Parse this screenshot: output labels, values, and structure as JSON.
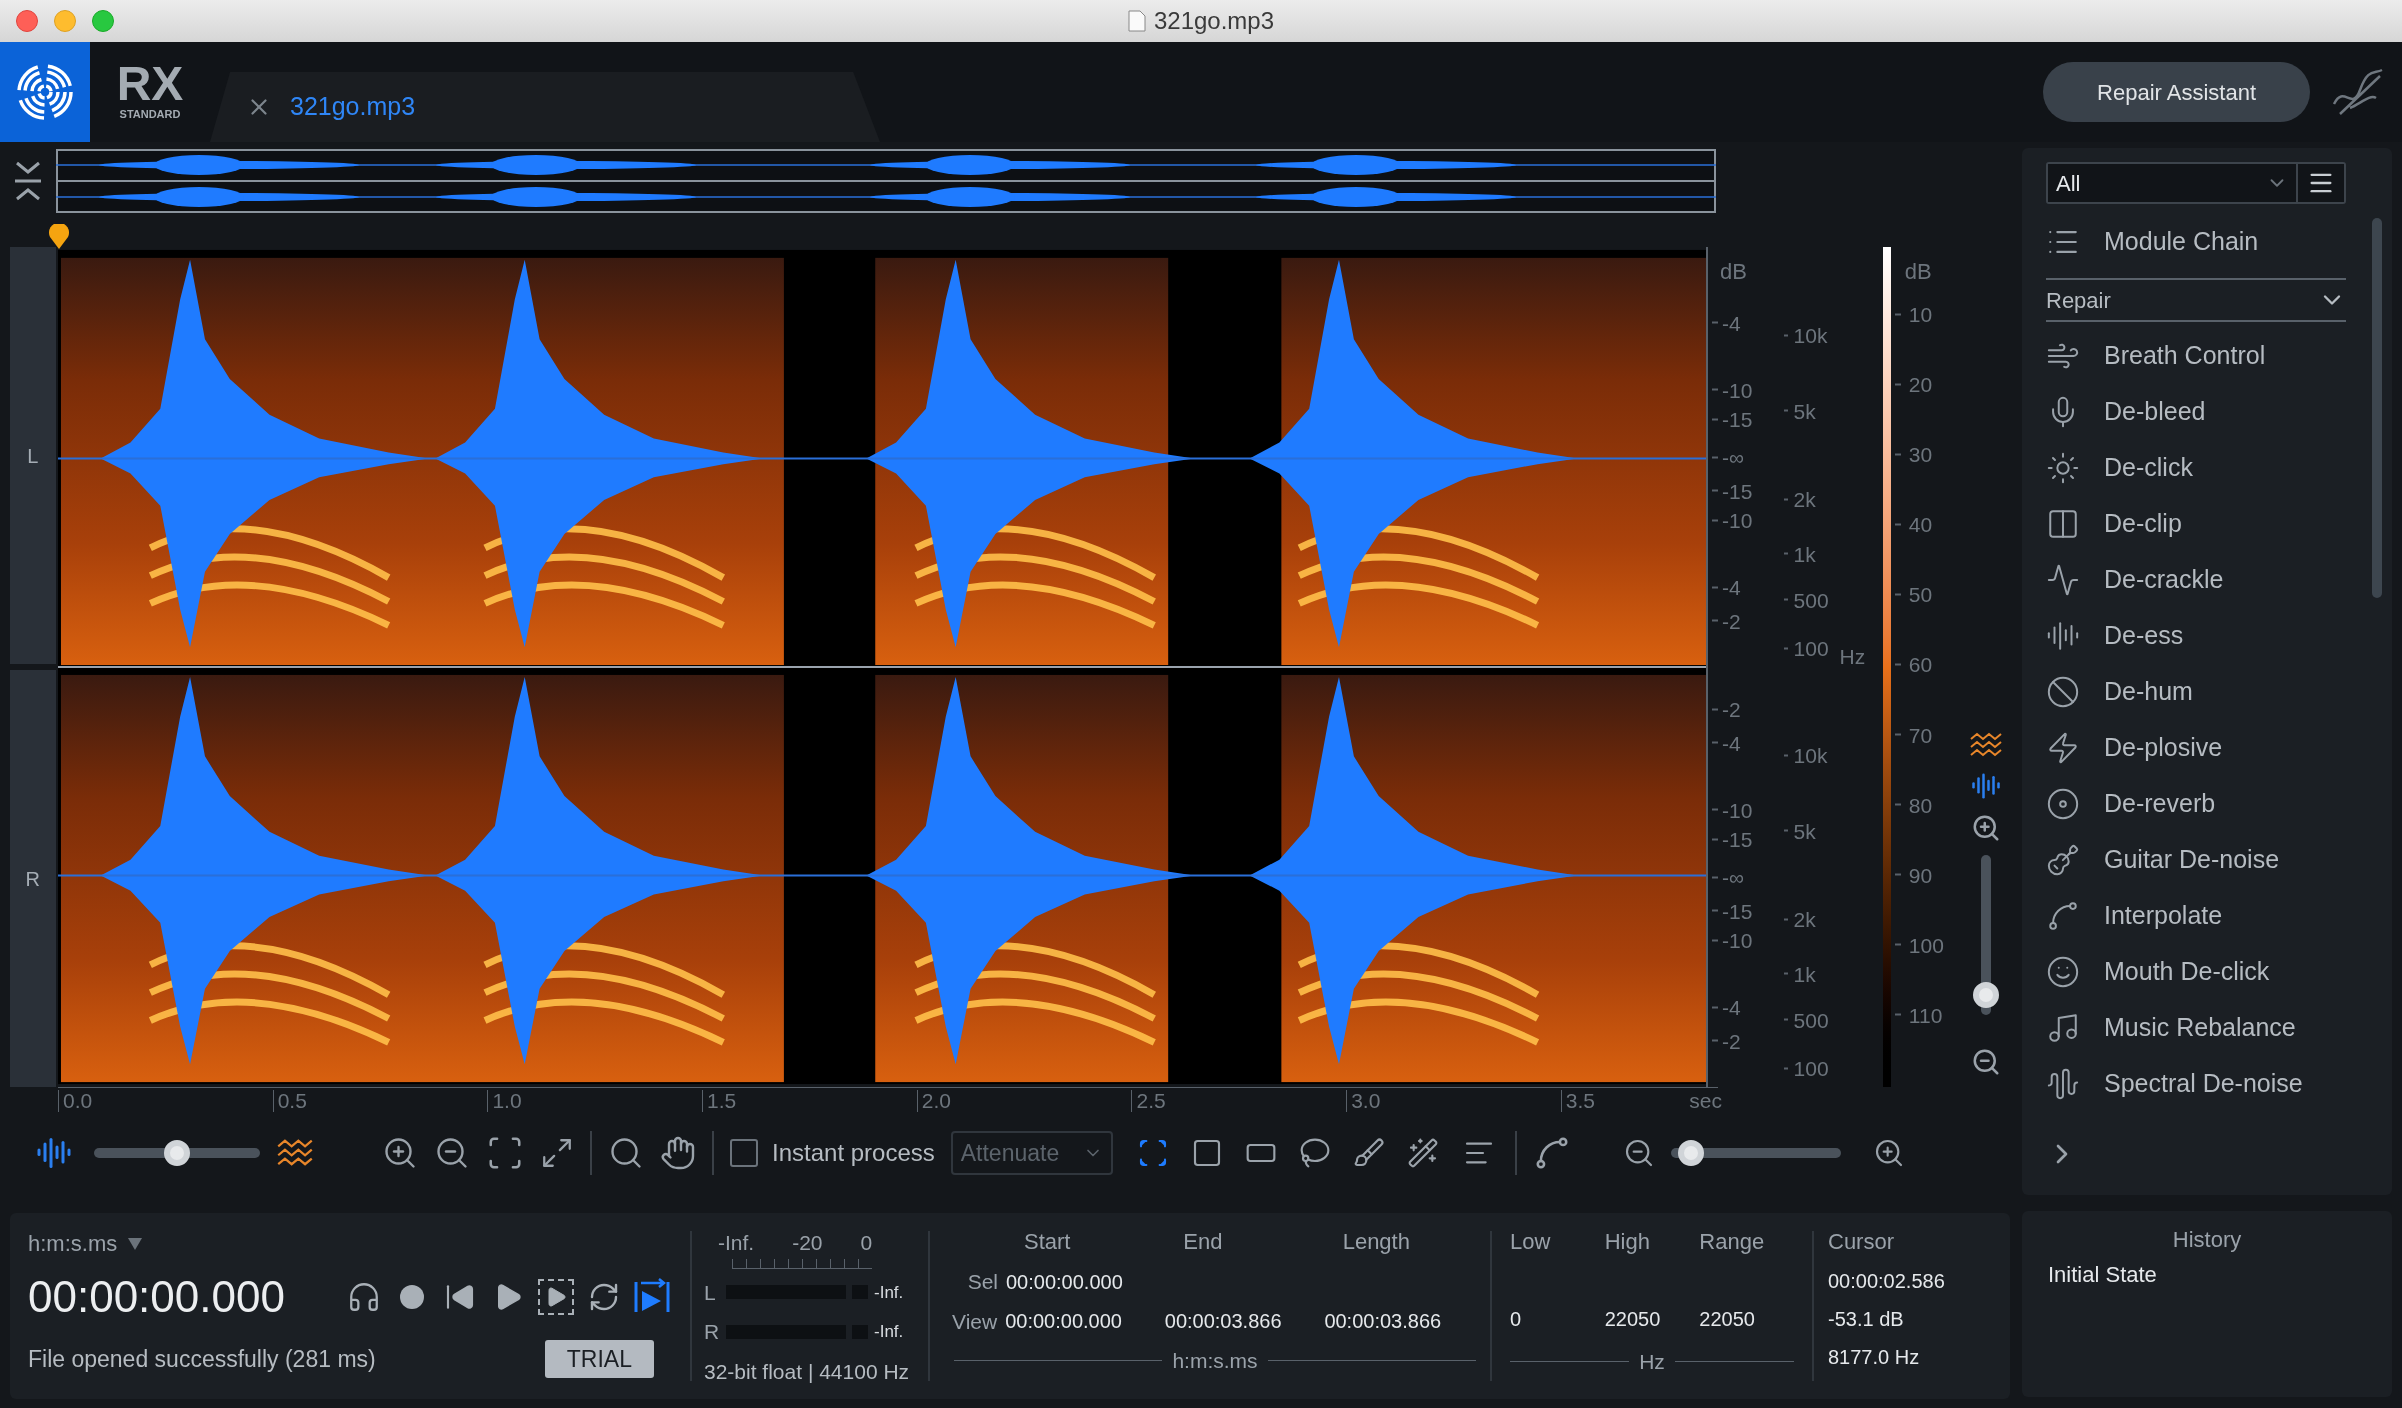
{
  "window": {
    "title": "321go.mp3"
  },
  "app": {
    "logo_text": "RX",
    "edition": "STANDARD"
  },
  "tabs": [
    {
      "label": "321go.mp3",
      "selected": true
    }
  ],
  "repair_assistant_button": "Repair Assistant",
  "channels": [
    {
      "label": "L",
      "db_unit": "dB",
      "db_ticks": [
        "-4",
        "-10",
        "-15",
        "-∞",
        "-15",
        "-10",
        "-4",
        "-2"
      ],
      "hz_ticks": [
        "10k",
        "5k",
        "2k",
        "1k",
        "500",
        "100"
      ],
      "hz_unit": "Hz"
    },
    {
      "label": "R",
      "db_ticks": [
        "-2",
        "-4",
        "-10",
        "-15",
        "-∞",
        "-15",
        "-10",
        "-4",
        "-2"
      ],
      "hz_ticks": [
        "10k",
        "5k",
        "2k",
        "1k",
        "500",
        "100"
      ]
    }
  ],
  "colorbar": {
    "unit": "dB",
    "ticks": [
      "10",
      "20",
      "30",
      "40",
      "50",
      "60",
      "70",
      "80",
      "90",
      "100",
      "110"
    ]
  },
  "vertical_zoom_slider": {
    "level": 0.05
  },
  "time_axis": {
    "ticks": [
      "0.0",
      "0.5",
      "1.0",
      "1.5",
      "2.0",
      "2.5",
      "3.0",
      "3.5"
    ],
    "unit": "sec"
  },
  "toolbar": {
    "blend_slider": {
      "level": 0.5
    },
    "instant_process": {
      "label": "Instant process",
      "checked": false
    },
    "mode_dropdown": {
      "value": "Attenuate",
      "disabled": true
    },
    "selection_tools": [
      {
        "kind": "time",
        "selected": true
      },
      {
        "kind": "rect",
        "selected": false
      },
      {
        "kind": "frequency",
        "selected": false
      },
      {
        "kind": "lasso",
        "selected": false
      },
      {
        "kind": "brush",
        "selected": false
      },
      {
        "kind": "wand",
        "selected": false
      },
      {
        "kind": "harmonic",
        "selected": false
      }
    ],
    "zoom_slider": {
      "level": 0.05
    }
  },
  "modules": {
    "filter": "All",
    "module_chain": "Module Chain",
    "category": "Repair",
    "items": [
      "Breath Control",
      "De-bleed",
      "De-click",
      "De-clip",
      "De-crackle",
      "De-ess",
      "De-hum",
      "De-plosive",
      "De-reverb",
      "Guitar De-noise",
      "Interpolate",
      "Mouth De-click",
      "Music Rebalance",
      "Spectral De-noise"
    ]
  },
  "transport": {
    "time_format": "h:m:s.ms",
    "time": "00:00:00.000",
    "status": "File opened successfully (281 ms)",
    "trial_button": "TRIAL",
    "buttons": [
      {
        "kind": "monitor",
        "on": false
      },
      {
        "kind": "record",
        "on": false
      },
      {
        "kind": "rewind",
        "on": false
      },
      {
        "kind": "play",
        "on": false
      },
      {
        "kind": "play_selection",
        "on": false
      },
      {
        "kind": "loop",
        "on": false
      },
      {
        "kind": "follow",
        "on": true
      }
    ]
  },
  "meter": {
    "scale": [
      "-Inf.",
      "-20",
      "0"
    ],
    "channels": [
      {
        "label": "L",
        "reading": "-Inf."
      },
      {
        "label": "R",
        "reading": "-Inf."
      }
    ],
    "format": "32-bit float | 44100 Hz"
  },
  "selection": {
    "headers": [
      "Start",
      "End",
      "Length"
    ],
    "rows": [
      {
        "label": "Sel",
        "values": [
          "00:00:00.000"
        ]
      },
      {
        "label": "View",
        "values": [
          "00:00:00.000",
          "00:00:03.866",
          "00:00:03.866"
        ]
      }
    ],
    "unit": "h:m:s.ms"
  },
  "frequency": {
    "headers": [
      "Low",
      "High",
      "Range"
    ],
    "values": [
      "0",
      "22050",
      "22050"
    ],
    "unit": "Hz"
  },
  "cursor": {
    "header": "Cursor",
    "values": [
      "00:00:02.586",
      "-53.1 dB",
      "8177.0 Hz"
    ]
  },
  "history": {
    "title": "History",
    "items": [
      "Initial State"
    ]
  }
}
